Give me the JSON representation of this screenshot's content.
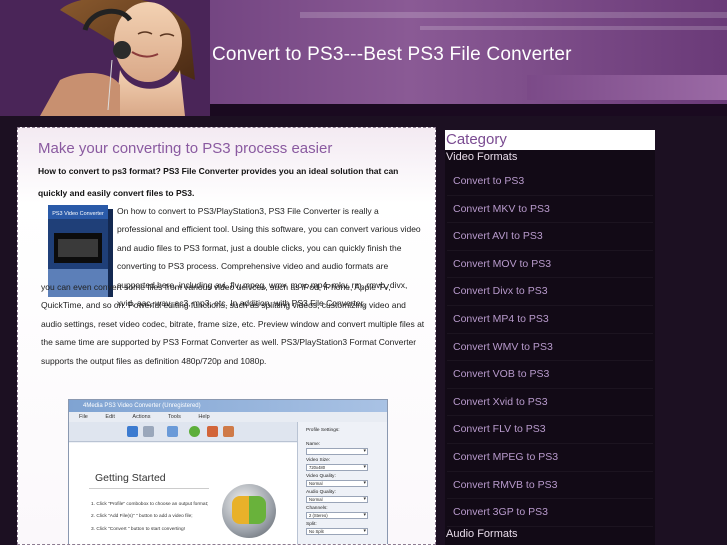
{
  "header": {
    "title": "Convert to PS3---Best PS3 File Converter"
  },
  "main": {
    "heading": "Make your converting to PS3 process easier",
    "intro": "How to convert to ps3 format? PS3 File Converter provides you an ideal solution that can quickly and easily convert files to PS3.",
    "box_art_label": "PS3 Video Converter",
    "paragraph_part1": "On how to convert to PS3/PlayStation3, PS3 File Converter is really a professional and efficient tool. Using this software, you can convert various video and audio files to PS3 format, just a double clicks, you can quickly finish the converting to PS3 process. Comprehensive video and audio formats are supported here, including avi, flv, mpeg, wmv, mov, mp4, mkv, rm, rmvb, divx, xvid, aac, wav, ac3, mp3, etc. In addition, with PS3 File Converter,",
    "paragraph_part2": "you can even convert some files from various video deivces, such as iPod, iPhone, Apple TV, QuickTime, and so on. Powerful editing functions, such as splitting videos, customizing video and audio settings, reset video codec, bitrate, frame size, etc. Preview window and convert multiple files at the same time are supported by PS3 Format Converter as well. PS3/PlayStation3 Format Converter supports the output files as definition 480p/720p and 1080p."
  },
  "app_screenshot": {
    "window_title": "4Media PS3 Video Converter (Unregistered)",
    "menu": [
      "File",
      "Edit",
      "Actions",
      "Tools",
      "Help"
    ],
    "getting_started": "Getting Started",
    "steps": [
      "1. Click \"Profile\" combobox to choose an output format;",
      "2. Click \"Add File(s)\"        \" button to add a video file;",
      "3. Click \"Convert        \" button to start converting!"
    ],
    "side": {
      "profile_settings": "Profile Settings:",
      "name_label": "Name:",
      "video_size_label": "Video Size:",
      "video_size_value": "720x480",
      "video_quality_label": "Video Quality:",
      "video_quality_value": "Normal",
      "audio_quality_label": "Audio Quality:",
      "audio_quality_value": "Normal",
      "channels_label": "Channels:",
      "channels_value": "2 (Stereo)",
      "split_label": "Split:",
      "split_value": "No Split"
    }
  },
  "sidebar": {
    "heading": "Category",
    "video_group": "Video Formats",
    "items": [
      "Convert to PS3",
      "Convert MKV to PS3",
      "Convert AVI to PS3",
      "Convert MOV to PS3",
      "Convert Divx to PS3",
      "Convert MP4 to PS3",
      "Convert WMV to PS3",
      "Convert VOB to PS3",
      "Convert Xvid to PS3",
      "Convert FLV to PS3",
      "Convert MPEG to PS3",
      "Convert RMVB to PS3",
      "Convert 3GP to PS3"
    ],
    "audio_group": "Audio Formats"
  },
  "colors": {
    "header_purple": "#6d3f7c",
    "heading_purple": "#8a5aa0",
    "link_lavender": "#b89acc",
    "sidebar_bg": "#120a16"
  }
}
